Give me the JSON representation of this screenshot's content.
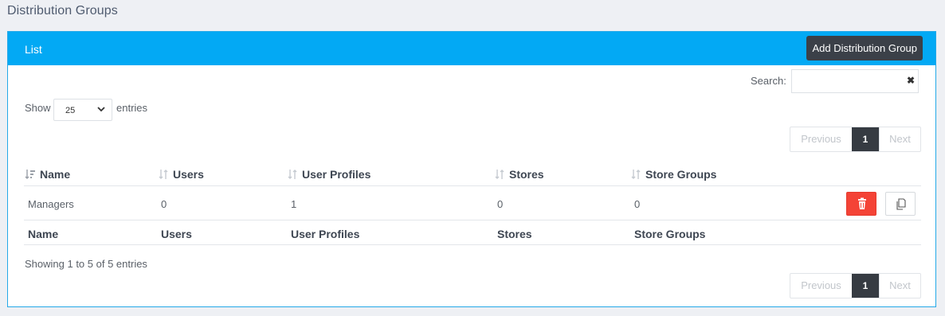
{
  "page": {
    "title": "Distribution Groups"
  },
  "card": {
    "title": "List",
    "add_button": "Add Distribution Group",
    "accent_color": "#03a9f4"
  },
  "search": {
    "label": "Search:",
    "value": "",
    "clear_icon": "close-icon"
  },
  "length": {
    "show_label": "Show",
    "selected": "25",
    "entries_label": "entries"
  },
  "pagination": {
    "previous": "Previous",
    "current": "1",
    "next": "Next"
  },
  "table": {
    "columns": [
      "Name",
      "Users",
      "User Profiles",
      "Stores",
      "Store Groups"
    ],
    "rows": [
      {
        "name": "Managers",
        "users": "0",
        "user_profiles": "1",
        "stores": "0",
        "store_groups": "0"
      }
    ],
    "footer": [
      "Name",
      "Users",
      "User Profiles",
      "Stores",
      "Store Groups"
    ]
  },
  "info": "Showing 1 to 5 of 5 entries",
  "colors": {
    "delete": "#f44336",
    "dark_button": "#3b4048"
  }
}
